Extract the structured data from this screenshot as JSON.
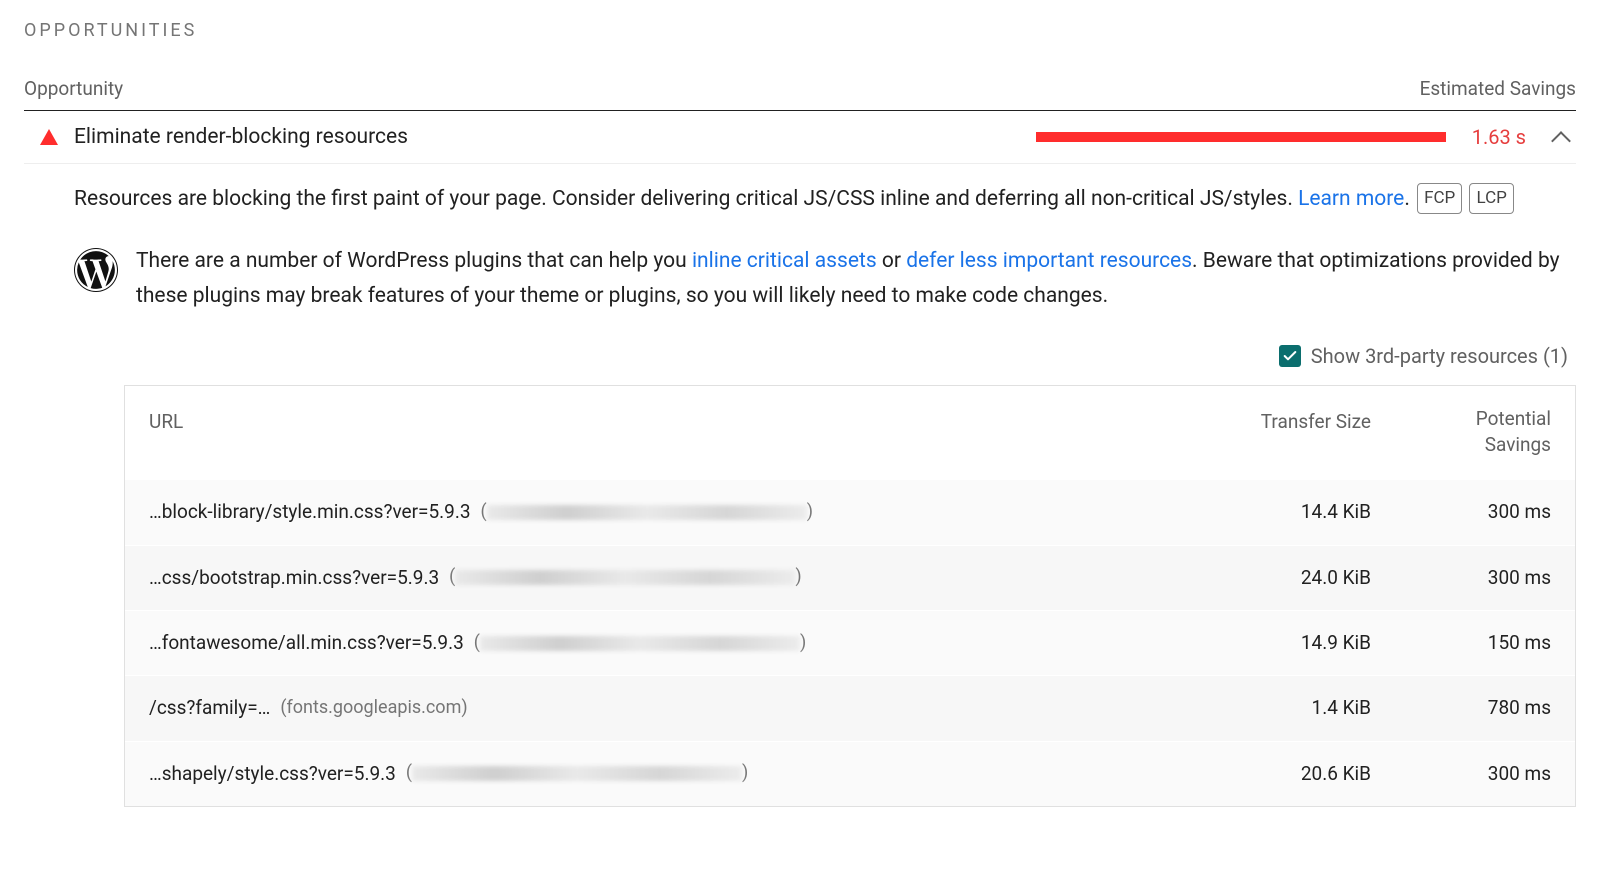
{
  "section_title": "OPPORTUNITIES",
  "header": {
    "opportunity": "Opportunity",
    "estimated_savings": "Estimated Savings"
  },
  "opportunity": {
    "title": "Eliminate render-blocking resources",
    "savings": "1.63 s"
  },
  "description": {
    "text_before": "Resources are blocking the first paint of your page. Consider delivering critical JS/CSS inline and deferring all non-critical JS/styles. ",
    "learn_more": "Learn more",
    "period": ".",
    "tags": [
      "FCP",
      "LCP"
    ]
  },
  "wordpress": {
    "t1": "There are a number of WordPress plugins that can help you ",
    "l1": "inline critical assets",
    "t2": " or ",
    "l2": "defer less important resources",
    "t3": ". Beware that optimizations provided by these plugins may break features of your theme or plugins, so you will likely need to make code changes."
  },
  "third_party": {
    "label": "Show 3rd-party resources (1)",
    "checked": true
  },
  "table": {
    "headers": {
      "url": "URL",
      "size": "Transfer Size",
      "savings": "Potential Savings"
    },
    "rows": [
      {
        "url": "…block-library/style.min.css?ver=5.9.3",
        "host_blurred": true,
        "host": "",
        "blur_width": 320,
        "size": "14.4 KiB",
        "savings": "300 ms"
      },
      {
        "url": "…css/bootstrap.min.css?ver=5.9.3",
        "host_blurred": true,
        "host": "",
        "blur_width": 340,
        "size": "24.0 KiB",
        "savings": "300 ms"
      },
      {
        "url": "…fontawesome/all.min.css?ver=5.9.3",
        "host_blurred": true,
        "host": "",
        "blur_width": 320,
        "size": "14.9 KiB",
        "savings": "150 ms"
      },
      {
        "url": "/css?family=…",
        "host_blurred": false,
        "host": "(fonts.googleapis.com)",
        "blur_width": 0,
        "size": "1.4 KiB",
        "savings": "780 ms"
      },
      {
        "url": "…shapely/style.css?ver=5.9.3",
        "host_blurred": true,
        "host": "",
        "blur_width": 330,
        "size": "20.6 KiB",
        "savings": "300 ms"
      }
    ]
  }
}
